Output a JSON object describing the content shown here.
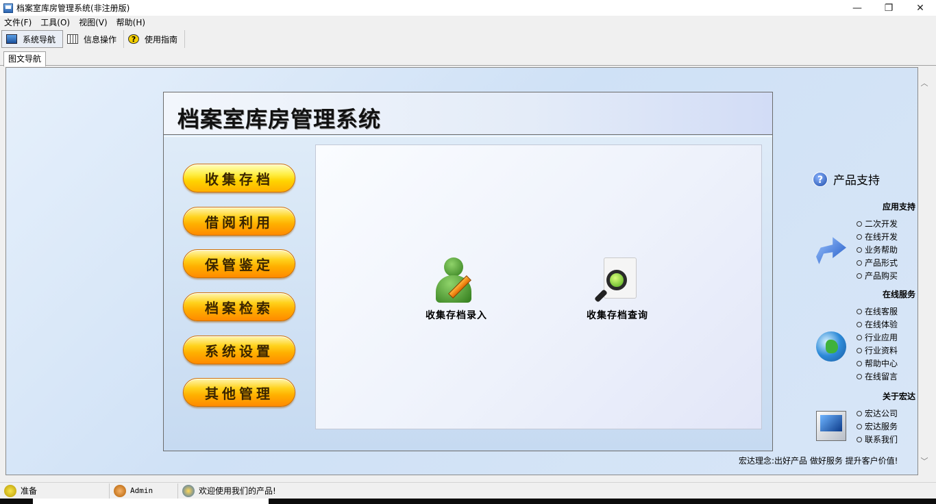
{
  "window": {
    "title": "档案室库房管理系统(非注册版)",
    "min": "—",
    "max": "❐",
    "close": "✕"
  },
  "menu": [
    "文件(F)",
    "工具(O)",
    "视图(V)",
    "帮助(H)"
  ],
  "toolbar": {
    "nav": "系统导航",
    "info": "信息操作",
    "guide": "使用指南"
  },
  "tab": "图文导航",
  "main": {
    "title": "档案室库房管理系统",
    "nav_buttons": [
      "收集存档",
      "借阅利用",
      "保管鉴定",
      "档案检索",
      "系统设置",
      "其他管理"
    ],
    "features": [
      "收集存档录入",
      "收集存档查询"
    ]
  },
  "side": {
    "title": "产品支持",
    "sections": [
      {
        "heading": "应用支持",
        "items": [
          "二次开发",
          "在线开发",
          "业务帮助",
          "产品形式",
          "产品购买"
        ]
      },
      {
        "heading": "在线服务",
        "items": [
          "在线客服",
          "在线体验",
          "行业应用",
          "行业资料",
          "帮助中心",
          "在线留言"
        ]
      },
      {
        "heading": "关于宏达",
        "items": [
          "宏达公司",
          "宏达服务",
          "联系我们"
        ]
      }
    ],
    "slogan": "宏达理念:出好产品 做好服务 提升客户价值!"
  },
  "status": {
    "ready": "准备",
    "user": "Admin",
    "welcome": "欢迎使用我们的产品!"
  }
}
